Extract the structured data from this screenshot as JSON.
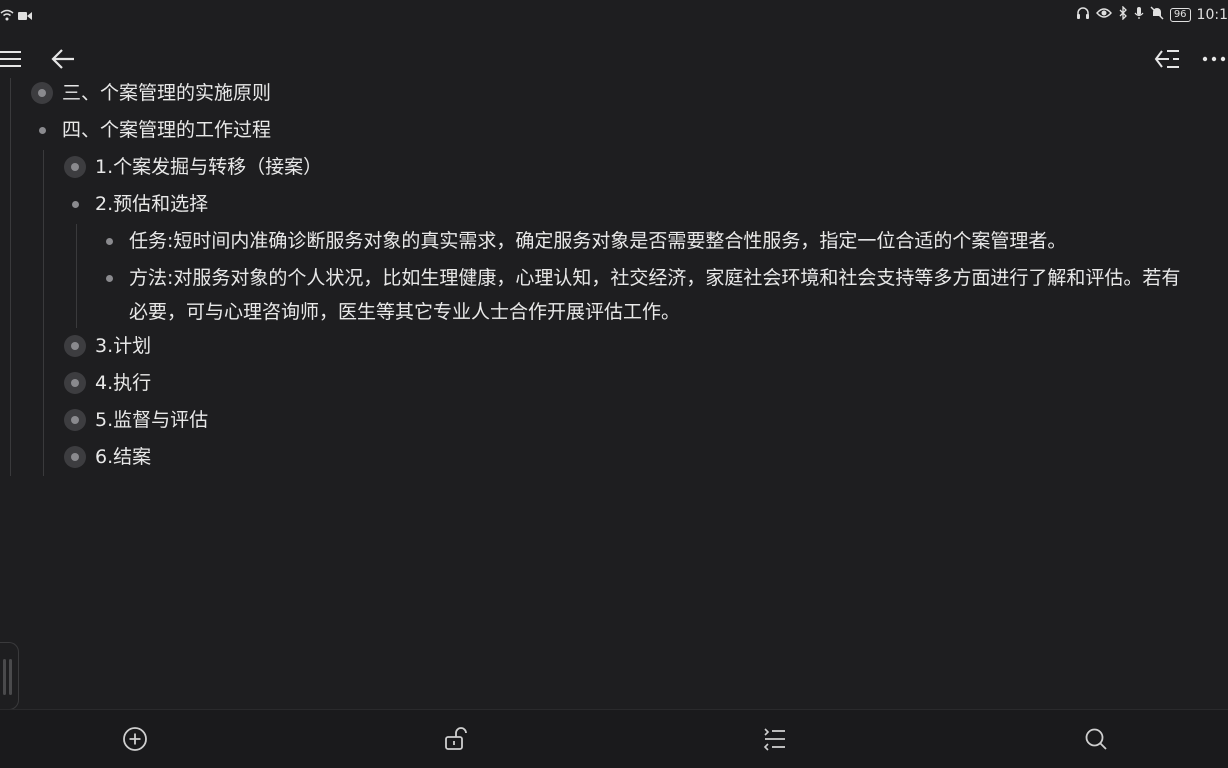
{
  "status": {
    "time": "10:1",
    "battery": "96"
  },
  "outline": {
    "items": [
      {
        "text": "三、个案管理的实施原则",
        "bullet": "collapsed"
      },
      {
        "text": "四、个案管理的工作过程",
        "bullet": "dot"
      },
      {
        "text": "1.个案发掘与转移（接案）",
        "bullet": "collapsed"
      },
      {
        "text": "2.预估和选择",
        "bullet": "dot"
      },
      {
        "text": "任务:短时间内准确诊断服务对象的真实需求，确定服务对象是否需要整合性服务，指定一位合适的个案管理者。",
        "bullet": "dot"
      },
      {
        "text": "方法:对服务对象的个人状况，比如生理健康，心理认知，社交经济，家庭社会环境和社会支持等多方面进行了解和评估。若有必要，可与心理咨询师，医生等其它专业人士合作开展评估工作。",
        "bullet": "dot"
      },
      {
        "text": "3.计划",
        "bullet": "collapsed"
      },
      {
        "text": "4.执行",
        "bullet": "collapsed"
      },
      {
        "text": "5.监督与评估",
        "bullet": "collapsed"
      },
      {
        "text": "6.结案",
        "bullet": "collapsed"
      }
    ]
  },
  "colors": {
    "background": "#1e1e20",
    "text": "#e8e8e8",
    "bullet": "#8a8a8e"
  }
}
